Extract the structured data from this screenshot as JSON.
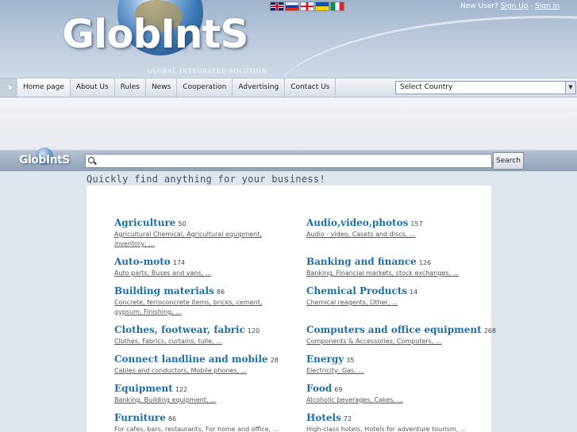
{
  "header": {
    "logo_text": "GlobIntS",
    "tagline": "GLOBAL INTEGRATED SOLUTION",
    "new_user": "New User?",
    "sign_up": "Sign Up",
    "separator": "·",
    "sign_in": "Sign In",
    "flags": [
      "uk-flag-icon",
      "ru-flag-icon",
      "ge-flag-icon",
      "ua-flag-icon",
      "it-flag-icon"
    ]
  },
  "nav": {
    "items": [
      {
        "label": "Home page"
      },
      {
        "label": "About Us"
      },
      {
        "label": "Rules"
      },
      {
        "label": "News"
      },
      {
        "label": "Cooperation"
      },
      {
        "label": "Advertising"
      },
      {
        "label": "Contact Us"
      }
    ],
    "select_country": "Select Country"
  },
  "search": {
    "logo_text": "GlobIntS",
    "value": "",
    "button": "Search",
    "tagline": "Quickly find anything for your business!"
  },
  "categories": [
    {
      "title": "Agriculture",
      "count": "50",
      "sub": "Agricultural Chemical, Agricultural equipment, inventory, ..."
    },
    {
      "title": "Audio,video,photos",
      "count": "157",
      "sub": "Audio - video, Casets and discs, ..."
    },
    {
      "title": "Auto-moto",
      "count": "174",
      "sub": "Auto parts, Buses and vans, ..."
    },
    {
      "title": "Banking and finance",
      "count": "126",
      "sub": "Banking, Financial markets, stock exchanges, ..."
    },
    {
      "title": "Building materials",
      "count": "86",
      "sub": "Concrete, ferroconcrete items, bricks, cement, gypsum, Finishing, ..."
    },
    {
      "title": "Chemical Products",
      "count": "14",
      "sub": "Chemical reagents, Other, ..."
    },
    {
      "title": "Clothes, footwear, fabric",
      "count": "120",
      "sub": "Clothes, Fabrics, curtains, tulle, ..."
    },
    {
      "title": "Computers and office equipment",
      "count": "268",
      "sub": "Components & Accessories, Computers, ..."
    },
    {
      "title": "Connect landline and mobile",
      "count": "28",
      "sub": "Cables and conductors, Mobile phones, ..."
    },
    {
      "title": "Energy",
      "count": "35",
      "sub": "Electricity, Gas, ..."
    },
    {
      "title": "Equipment",
      "count": "122",
      "sub": "Banking, Building equipment, ..."
    },
    {
      "title": "Food",
      "count": "69",
      "sub": "Alcoholic beverages, Cakes, ..."
    },
    {
      "title": "Furniture",
      "count": "86",
      "sub": "For cafes, bars, restaurants, For home and office, ..."
    },
    {
      "title": "Hotels",
      "count": "72",
      "sub": "High-class hotels, Hotels for adventure tourism, ..."
    }
  ]
}
